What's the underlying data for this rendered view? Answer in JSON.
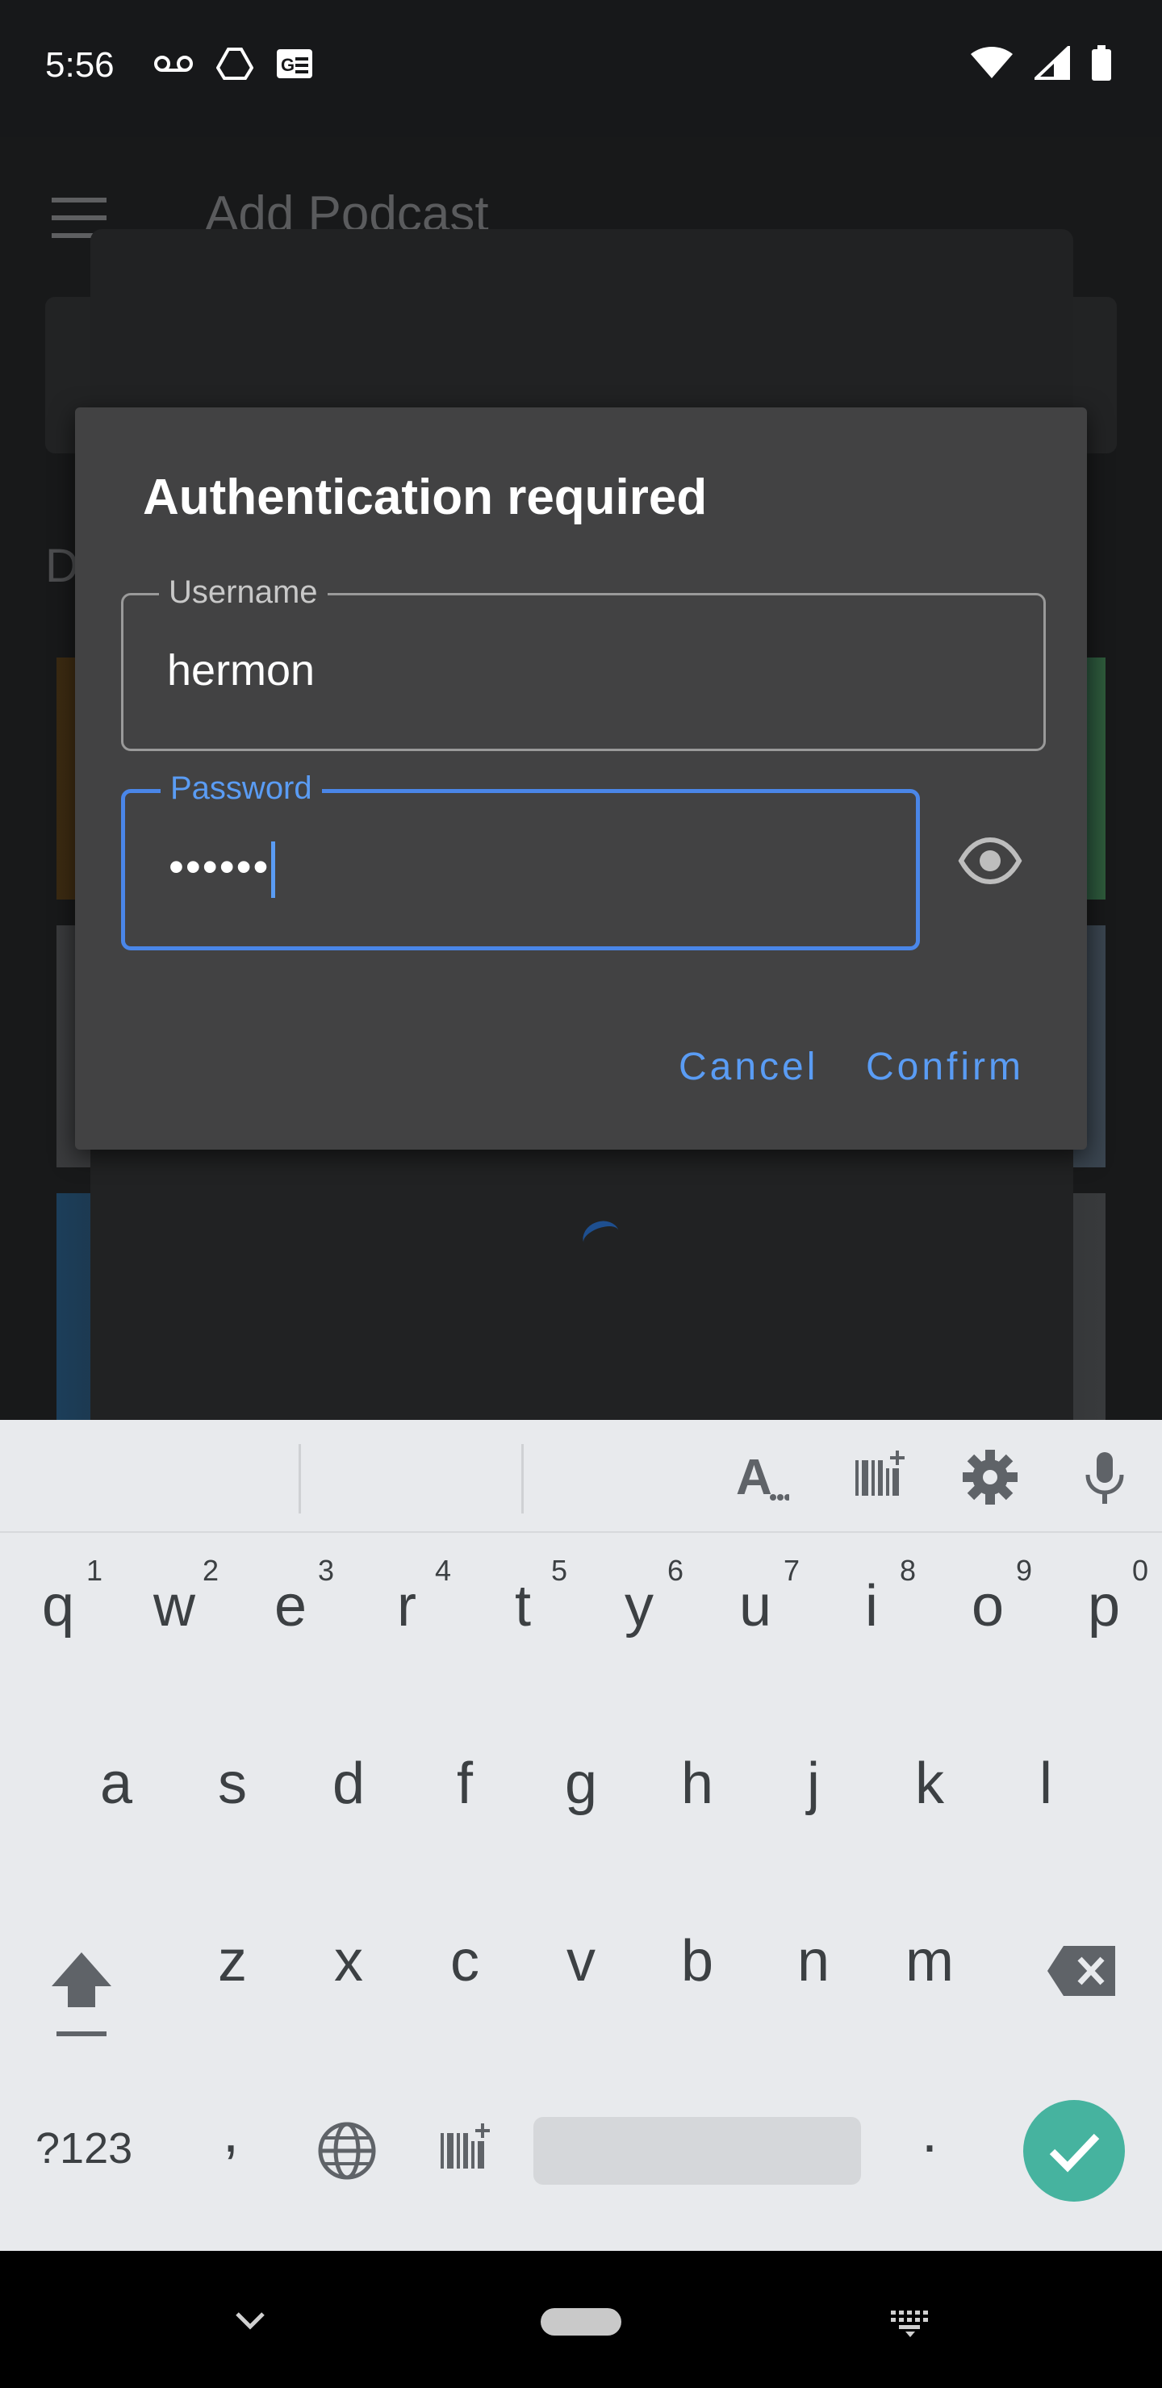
{
  "status_bar": {
    "time": "5:56",
    "left_icons": [
      "voicemail-icon",
      "drive-icon",
      "news-icon"
    ],
    "right_icons": [
      "wifi-icon",
      "signal-icon",
      "battery-icon"
    ]
  },
  "background_app": {
    "title": "Add Podcast",
    "section_label": "D"
  },
  "dialog": {
    "title": "Authentication required",
    "username": {
      "label": "Username",
      "value": "hermon"
    },
    "password": {
      "label": "Password",
      "value": "••••••"
    },
    "cancel_label": "Cancel",
    "confirm_label": "Confirm"
  },
  "keyboard": {
    "toolbar_icons": [
      "text-style-icon",
      "barcode-icon",
      "settings-icon",
      "mic-icon"
    ],
    "numbers": [
      "1",
      "2",
      "3",
      "4",
      "5",
      "6",
      "7",
      "8",
      "9",
      "0"
    ],
    "row1": [
      "q",
      "w",
      "e",
      "r",
      "t",
      "y",
      "u",
      "i",
      "o",
      "p"
    ],
    "row2": [
      "a",
      "s",
      "d",
      "f",
      "g",
      "h",
      "j",
      "k",
      "l"
    ],
    "row3": [
      "z",
      "x",
      "c",
      "v",
      "b",
      "n",
      "m"
    ],
    "symbols_label": "?123",
    "comma": ",",
    "period": "."
  },
  "colors": {
    "accent": "#4a86e8",
    "enter_key": "#46b39f",
    "dialog_bg": "#424243"
  }
}
